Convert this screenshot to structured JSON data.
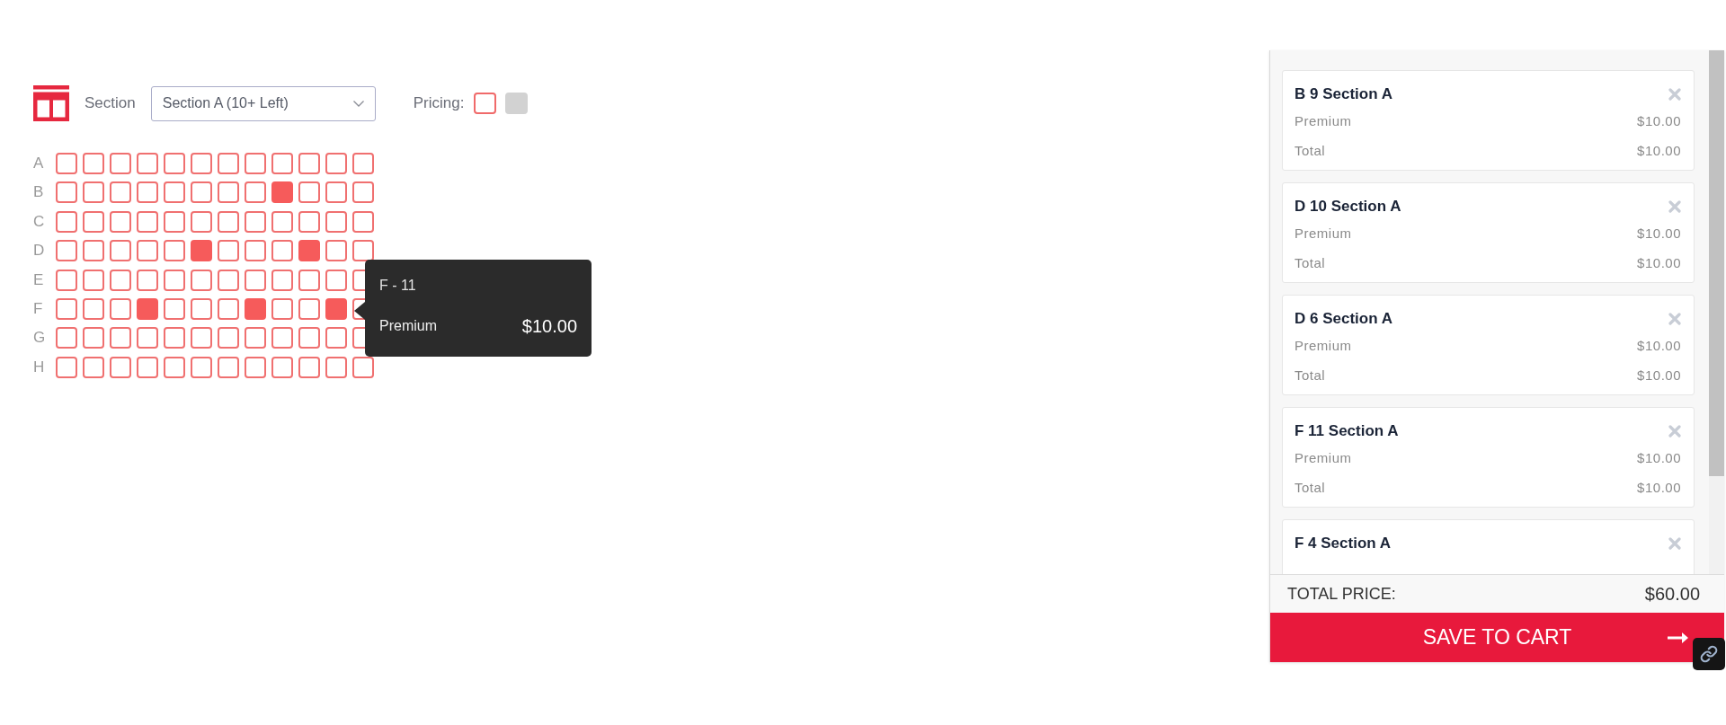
{
  "toolbar": {
    "section_label": "Section",
    "section_select": {
      "value": "Section A (10+ Left)"
    },
    "pricing_label": "Pricing:",
    "pricing_swatches": [
      {
        "kind": "outline",
        "color": "#f06a6a"
      },
      {
        "kind": "filled",
        "color": "#d2d2d2"
      }
    ]
  },
  "seat_map": {
    "rows": [
      {
        "label": "A",
        "seats": [
          {
            "selected": false
          },
          {
            "selected": false
          },
          {
            "selected": false
          },
          {
            "selected": false
          },
          {
            "selected": false
          },
          {
            "selected": false
          },
          {
            "selected": false
          },
          {
            "selected": false
          },
          {
            "selected": false
          },
          {
            "selected": false
          },
          {
            "selected": false
          },
          {
            "selected": false
          }
        ]
      },
      {
        "label": "B",
        "seats": [
          {
            "selected": false
          },
          {
            "selected": false
          },
          {
            "selected": false
          },
          {
            "selected": false
          },
          {
            "selected": false
          },
          {
            "selected": false
          },
          {
            "selected": false
          },
          {
            "selected": false
          },
          {
            "selected": true
          },
          {
            "selected": false
          },
          {
            "selected": false
          },
          {
            "selected": false
          }
        ]
      },
      {
        "label": "C",
        "seats": [
          {
            "selected": false
          },
          {
            "selected": false
          },
          {
            "selected": false
          },
          {
            "selected": false
          },
          {
            "selected": false
          },
          {
            "selected": false
          },
          {
            "selected": false
          },
          {
            "selected": false
          },
          {
            "selected": false
          },
          {
            "selected": false
          },
          {
            "selected": false
          },
          {
            "selected": false
          }
        ]
      },
      {
        "label": "D",
        "seats": [
          {
            "selected": false
          },
          {
            "selected": false
          },
          {
            "selected": false
          },
          {
            "selected": false
          },
          {
            "selected": false
          },
          {
            "selected": true
          },
          {
            "selected": false
          },
          {
            "selected": false
          },
          {
            "selected": false
          },
          {
            "selected": true
          },
          {
            "selected": false
          },
          {
            "selected": false
          }
        ]
      },
      {
        "label": "E",
        "seats": [
          {
            "selected": false
          },
          {
            "selected": false
          },
          {
            "selected": false
          },
          {
            "selected": false
          },
          {
            "selected": false
          },
          {
            "selected": false
          },
          {
            "selected": false
          },
          {
            "selected": false
          },
          {
            "selected": false
          },
          {
            "selected": false
          },
          {
            "selected": false
          },
          {
            "selected": false
          }
        ]
      },
      {
        "label": "F",
        "seats": [
          {
            "selected": false
          },
          {
            "selected": false
          },
          {
            "selected": false
          },
          {
            "selected": true
          },
          {
            "selected": false
          },
          {
            "selected": false
          },
          {
            "selected": false
          },
          {
            "selected": true
          },
          {
            "selected": false
          },
          {
            "selected": false
          },
          {
            "selected": true
          },
          {
            "selected": false
          }
        ]
      },
      {
        "label": "G",
        "seats": [
          {
            "selected": false
          },
          {
            "selected": false
          },
          {
            "selected": false
          },
          {
            "selected": false
          },
          {
            "selected": false
          },
          {
            "selected": false
          },
          {
            "selected": false
          },
          {
            "selected": false
          },
          {
            "selected": false
          },
          {
            "selected": false
          },
          {
            "selected": false
          },
          {
            "selected": false
          }
        ]
      },
      {
        "label": "H",
        "seats": [
          {
            "selected": false
          },
          {
            "selected": false
          },
          {
            "selected": false
          },
          {
            "selected": false
          },
          {
            "selected": false
          },
          {
            "selected": false
          },
          {
            "selected": false
          },
          {
            "selected": false
          },
          {
            "selected": false
          },
          {
            "selected": false
          },
          {
            "selected": false
          },
          {
            "selected": false
          }
        ]
      }
    ]
  },
  "tooltip": {
    "title": "F - 11",
    "category": "Premium",
    "price": "$10.00"
  },
  "cart": {
    "items": [
      {
        "title": "B 9 Section A",
        "lines": [
          {
            "label": "Premium",
            "value": "$10.00"
          },
          {
            "label": "Total",
            "value": "$10.00"
          }
        ]
      },
      {
        "title": "D 10 Section A",
        "lines": [
          {
            "label": "Premium",
            "value": "$10.00"
          },
          {
            "label": "Total",
            "value": "$10.00"
          }
        ]
      },
      {
        "title": "D 6 Section A",
        "lines": [
          {
            "label": "Premium",
            "value": "$10.00"
          },
          {
            "label": "Total",
            "value": "$10.00"
          }
        ]
      },
      {
        "title": "F 11 Section A",
        "lines": [
          {
            "label": "Premium",
            "value": "$10.00"
          },
          {
            "label": "Total",
            "value": "$10.00"
          }
        ]
      },
      {
        "title": "F 4 Section A"
      }
    ],
    "total_label": "TOTAL PRICE:",
    "total_value": "$60.00",
    "save_button": "SAVE TO CART"
  }
}
